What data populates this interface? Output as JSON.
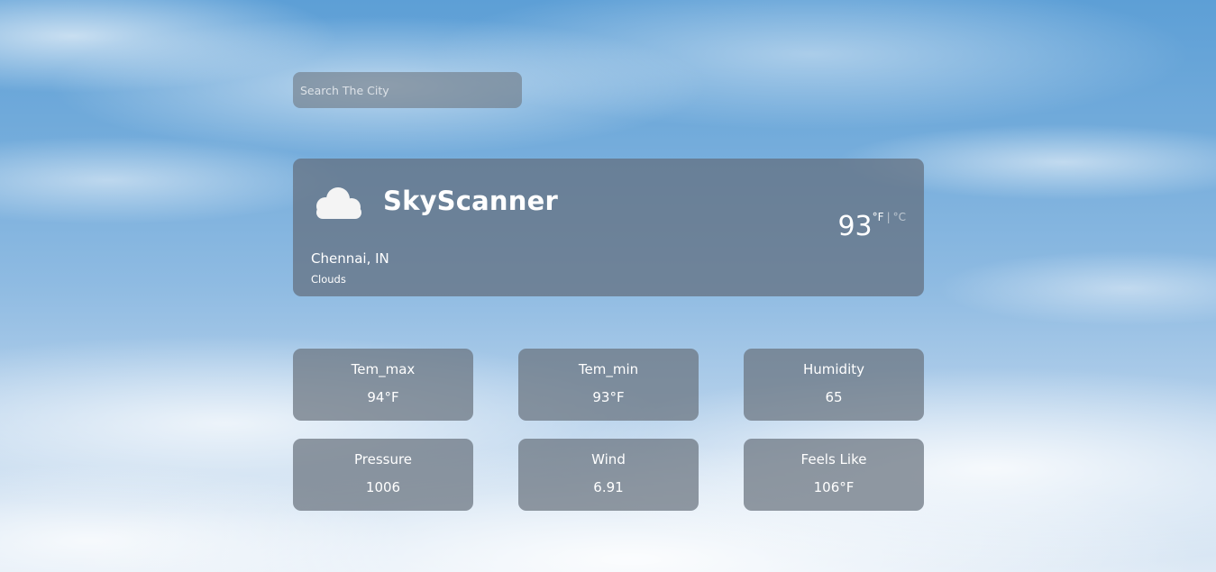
{
  "search": {
    "placeholder": "Search The City",
    "value": ""
  },
  "weather": {
    "app_name": "SkyScanner",
    "icon": "cloud-icon",
    "temperature": "93",
    "unit_f": "°F",
    "unit_separator": "|",
    "unit_c": "°C",
    "city": "Chennai, IN",
    "condition": "Clouds"
  },
  "stats": [
    {
      "label": "Tem_max",
      "value": "94°F"
    },
    {
      "label": "Tem_min",
      "value": "93°F"
    },
    {
      "label": "Humidity",
      "value": "65"
    },
    {
      "label": "Pressure",
      "value": "1006"
    },
    {
      "label": "Wind",
      "value": "6.91"
    },
    {
      "label": "Feels Like",
      "value": "106°F"
    }
  ]
}
